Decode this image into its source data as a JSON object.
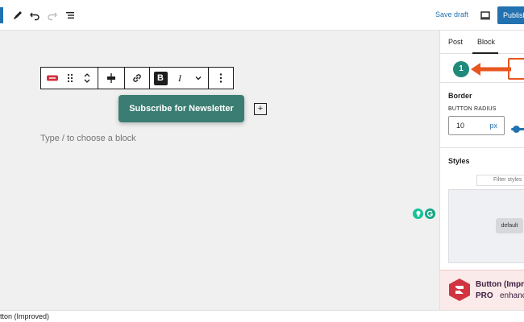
{
  "topbar": {
    "icons": [
      "pencil-icon",
      "undo-icon",
      "redo-icon",
      "list-view-icon",
      "preview-desktop-icon"
    ],
    "save_draft_label": "Save draft",
    "publish_label": "Publish"
  },
  "canvas": {
    "toolbar": {
      "items": [
        "button-block-icon",
        "drag-handle-icon",
        "move-up-down-icon",
        "align-icon",
        "link-icon",
        "bold-icon",
        "italic-icon",
        "more-formatting-chevron-icon",
        "options-icon"
      ],
      "bold_glyph": "B",
      "italic_glyph": "I"
    },
    "button_text": "Subscribe for Newsletter",
    "inserter_label": "+",
    "placeholder": "Type / to choose a block"
  },
  "sidebar": {
    "tabs": [
      "Post",
      "Block"
    ],
    "active_tab": "Block",
    "annotation_number": "1",
    "border": {
      "title": "Border",
      "radius_label": "BUTTON RADIUS",
      "radius_value": "10",
      "radius_unit": "px"
    },
    "styles": {
      "title": "Styles",
      "filter_placeholder": "Filter styles",
      "default_chip": "default"
    },
    "promo": {
      "line1": "Button (Improv",
      "line2_bold": "PRO",
      "line2_rest": "enhancem"
    }
  },
  "footer": {
    "breadcrumb": "tton (Improved)"
  },
  "colors": {
    "accent": "#2271b1",
    "button_bg": "#3b7d72",
    "annotation_green": "#1f8a7a",
    "annotation_orange": "#e8561f",
    "promo_red": "#d03440"
  }
}
